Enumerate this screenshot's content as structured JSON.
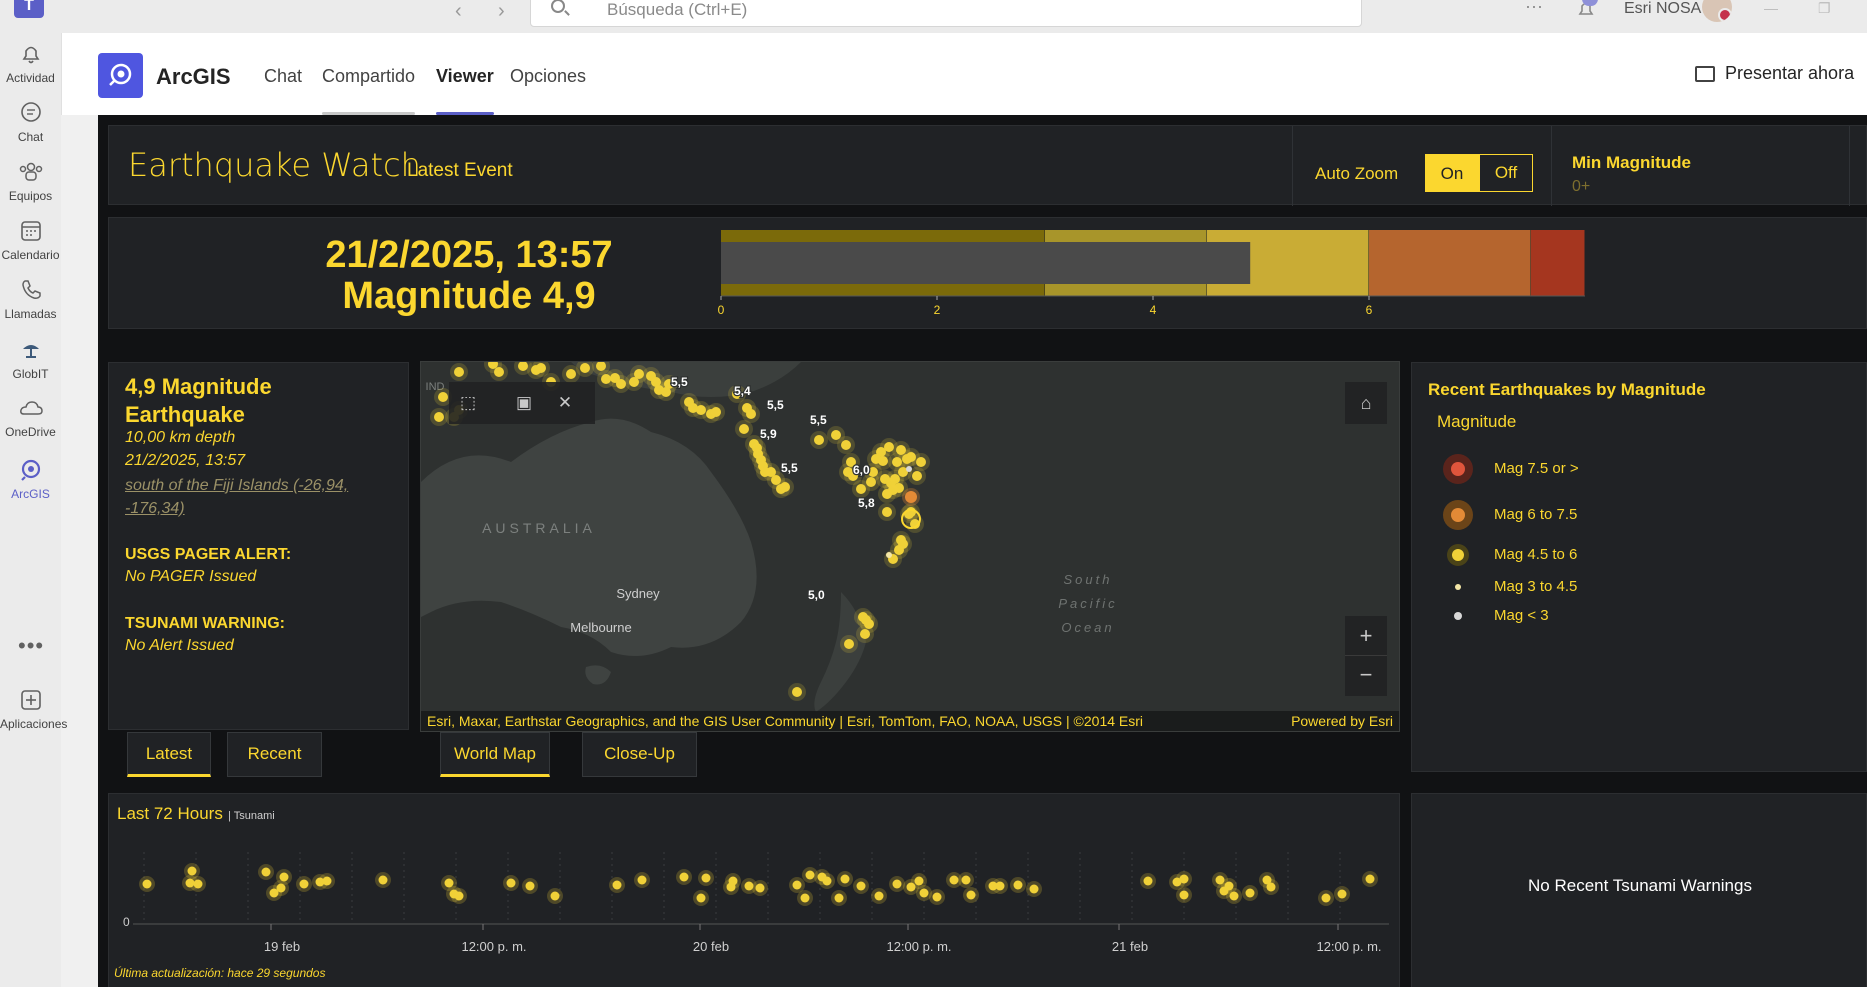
{
  "titlebar": {
    "app_icon": "teams-icon",
    "search_placeholder": "Búsqueda (Ctrl+E)",
    "user_name": "Esri NOSA",
    "more_label": "···"
  },
  "rail": {
    "items": [
      {
        "label": "Actividad",
        "icon": "bell-icon"
      },
      {
        "label": "Chat",
        "icon": "chat-icon"
      },
      {
        "label": "Equipos",
        "icon": "teams-icon"
      },
      {
        "label": "Calendario",
        "icon": "calendar-icon"
      },
      {
        "label": "Llamadas",
        "icon": "phone-icon"
      },
      {
        "label": "GlobIT",
        "icon": "globit-icon"
      },
      {
        "label": "OneDrive",
        "icon": "cloud-icon"
      },
      {
        "label": "ArcGIS",
        "icon": "arcgis-icon"
      },
      {
        "label": "Aplicaciones",
        "icon": "add-app-icon"
      }
    ],
    "more_label": "•••"
  },
  "app_header": {
    "title": "ArcGIS",
    "tabs": [
      {
        "label": "Chat"
      },
      {
        "label": "Compartido"
      },
      {
        "label": "Viewer"
      },
      {
        "label": "Opciones"
      }
    ],
    "active_tab": "Viewer",
    "present_label": "Presentar ahora"
  },
  "dashboard": {
    "title": "Earthquake Watch",
    "subtitle": "Latest Event",
    "auto_zoom_label": "Auto Zoom",
    "auto_zoom_on": "On",
    "auto_zoom_off": "Off",
    "min_magnitude_label": "Min Magnitude",
    "min_magnitude_value": "0+",
    "accent_color": "#fbd72f"
  },
  "latest_event": {
    "datetime": "21/2/2025, 13:57",
    "magnitude_text": "Magnitude 4,9",
    "gauge": {
      "value": 4.9,
      "max": 8,
      "ticks": [
        "0",
        "2",
        "4",
        "6"
      ],
      "bands": [
        {
          "from": 0,
          "to": 3,
          "color": "#7b6a0a"
        },
        {
          "from": 3,
          "to": 4.5,
          "color": "#a8952a"
        },
        {
          "from": 4.5,
          "to": 6,
          "color": "#c9ac35"
        },
        {
          "from": 6,
          "to": 7.5,
          "color": "#b5652e"
        },
        {
          "from": 7.5,
          "to": 8,
          "color": "#a5361f"
        }
      ]
    }
  },
  "details": {
    "headline": "4,9 Magnitude Earthquake",
    "depth": "10,00 km depth",
    "datetime": "21/2/2025, 13:57",
    "location": "south of the Fiji Islands (-26,94, -176,34)",
    "pager_label": "USGS PAGER ALERT:",
    "pager_value": "No PAGER Issued",
    "tsunami_label": "TSUNAMI WARNING:",
    "tsunami_value": "No Alert Issued"
  },
  "detail_tabs": [
    {
      "label": "Latest"
    },
    {
      "label": "Recent"
    }
  ],
  "map": {
    "place_labels": [
      "AUSTRALIA",
      "Sydney",
      "Melbourne",
      "South",
      "Pacific",
      "Ocean",
      "IND"
    ],
    "magnitude_labels": [
      "5,5",
      "5,4",
      "5,5",
      "5,5",
      "5,9",
      "5,5",
      "6,0",
      "5,8",
      "5,0"
    ],
    "attribution": "Esri, Maxar, Earthstar Geographics, and the GIS User Community | Esri, TomTom, FAO, NOAA, USGS | ©2014 Esri",
    "powered_by": "Powered by Esri",
    "zoom_in": "+",
    "zoom_out": "−"
  },
  "map_tabs": [
    {
      "label": "World Map"
    },
    {
      "label": "Close-Up"
    }
  ],
  "legend": {
    "title": "Recent Earthquakes by Magnitude",
    "subtitle": "Magnitude",
    "items": [
      {
        "label": "Mag 7.5 or >",
        "color": "#e0553c"
      },
      {
        "label": "Mag 6 to 7.5",
        "color": "#e38a36"
      },
      {
        "label": "Mag 4.5 to 6",
        "color": "#f0d138"
      },
      {
        "label": "Mag 3 to 4.5",
        "color": "#f3e6a6"
      },
      {
        "label": "Mag < 3",
        "color": "#d8d8d8"
      }
    ]
  },
  "timeline": {
    "title": "Last 72 Hours",
    "subtitle": "| Tsunami",
    "zero_label": "0",
    "x_labels": [
      "19 feb",
      "12:00 p. m.",
      "20 feb",
      "12:00 p. m.",
      "21 feb",
      "12:00 p. m."
    ],
    "updated": "Última actualización: hace 29 segundos"
  },
  "tsunami": {
    "message": "No Recent Tsunami Warnings"
  }
}
